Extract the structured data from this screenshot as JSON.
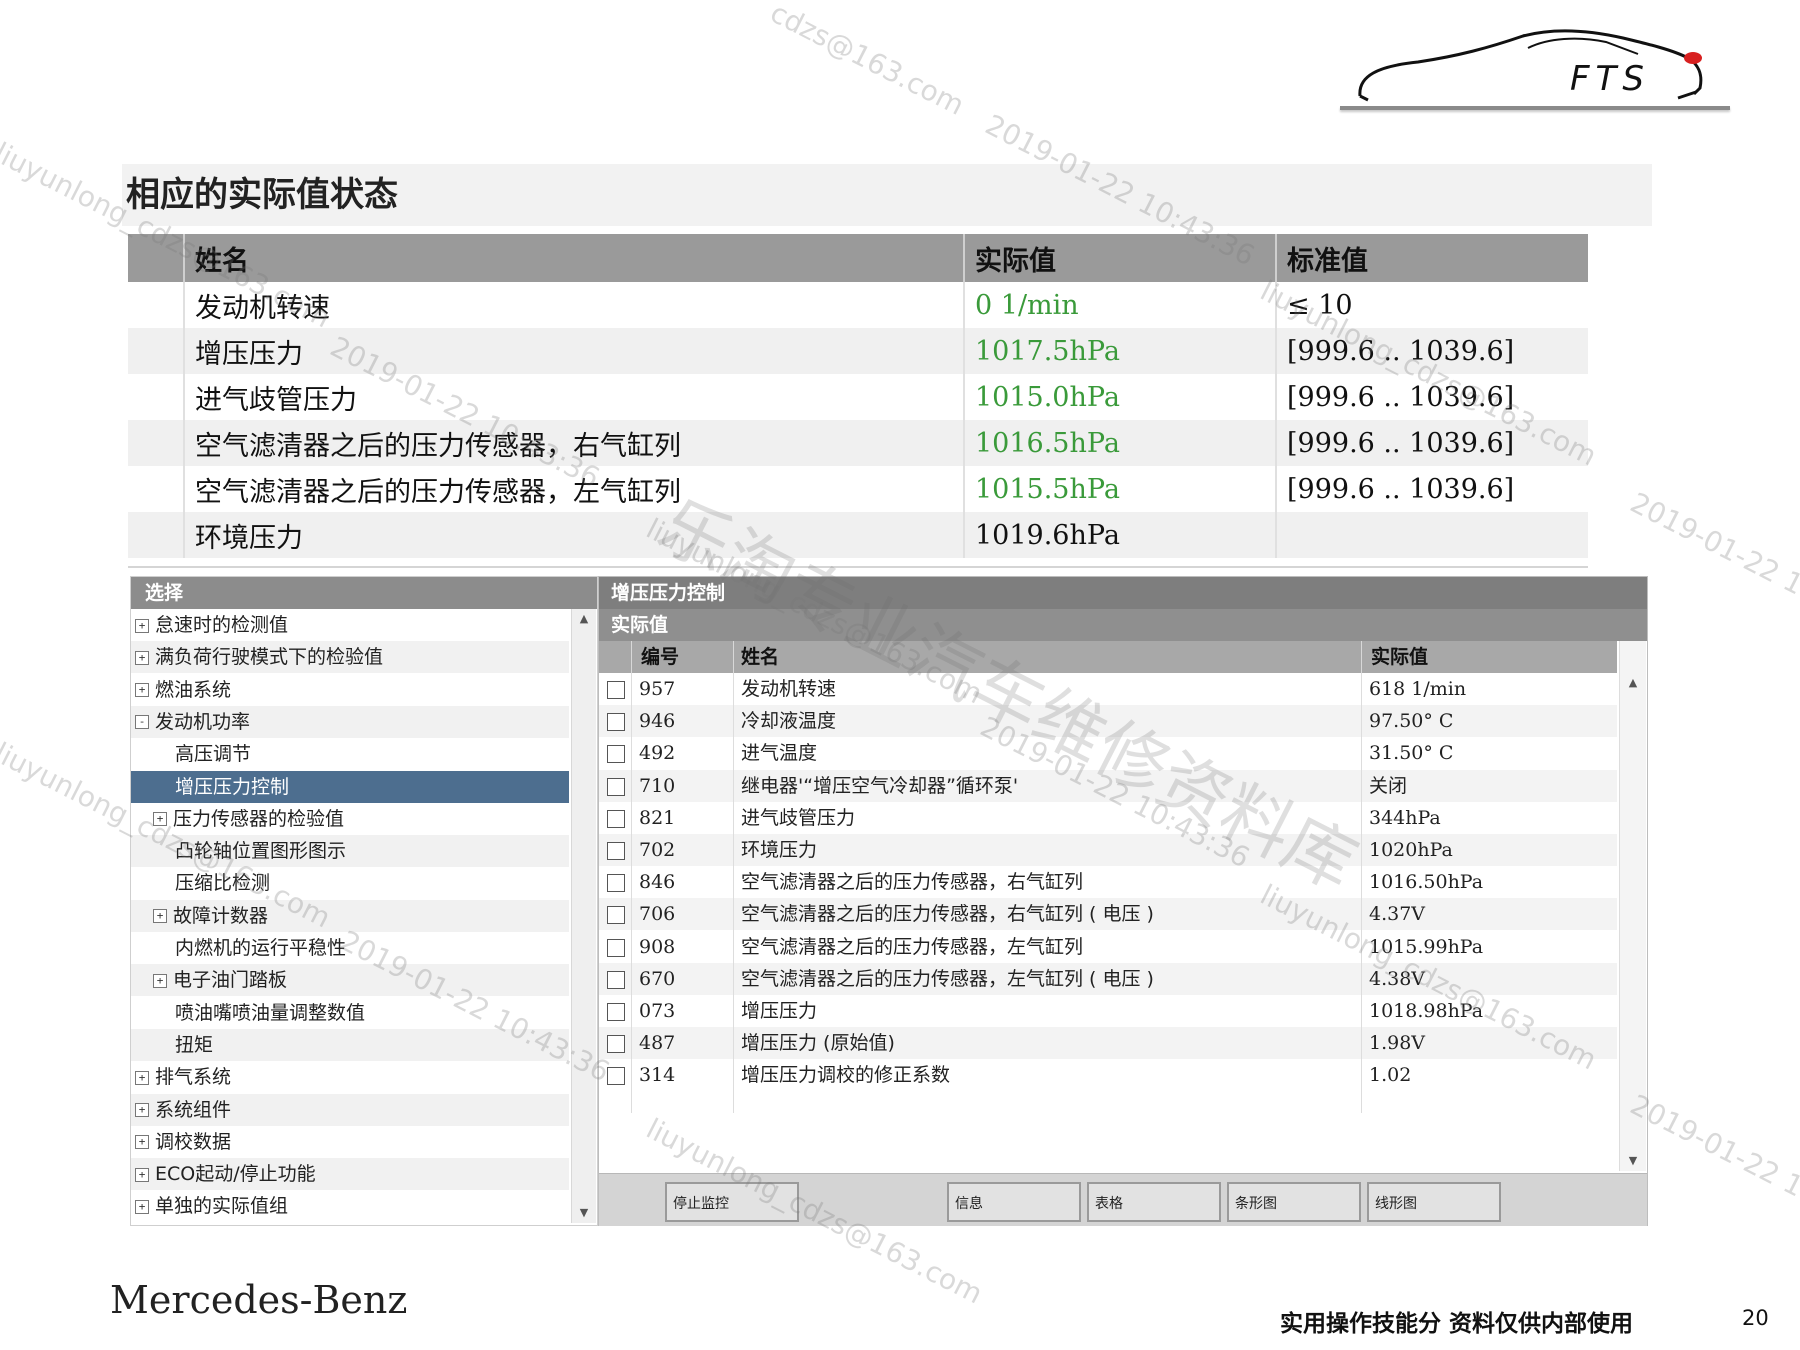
{
  "heading": "相应的实际值状态",
  "upper_table": {
    "headers": [
      "姓名",
      "实际值",
      "标准值"
    ],
    "rows": [
      {
        "name": "发动机转速",
        "actual": "0 1/min",
        "standard": "≤ 10"
      },
      {
        "name": "增压压力",
        "actual": "1017.5hPa",
        "standard": "[999.6 .. 1039.6]"
      },
      {
        "name": "进气歧管压力",
        "actual": "1015.0hPa",
        "standard": "[999.6 .. 1039.6]"
      },
      {
        "name": "空气滤清器之后的压力传感器，右气缸列",
        "actual": "1016.5hPa",
        "standard": "[999.6 .. 1039.6]"
      },
      {
        "name": "空气滤清器之后的压力传感器，左气缸列",
        "actual": "1015.5hPa",
        "standard": "[999.6 .. 1039.6]"
      },
      {
        "name": "环境压力",
        "actual": "1019.6hPa",
        "standard": ""
      }
    ]
  },
  "tree": {
    "header": "选择",
    "items": [
      {
        "label": "怠速时的检测值",
        "expander": "+",
        "indent": 0
      },
      {
        "label": "满负荷行驶模式下的检验值",
        "expander": "+",
        "indent": 0
      },
      {
        "label": "燃油系统",
        "expander": "+",
        "indent": 0
      },
      {
        "label": "发动机功率",
        "expander": "-",
        "indent": 0
      },
      {
        "label": "高压调节",
        "expander": "",
        "indent": 1
      },
      {
        "label": "增压压力控制",
        "expander": "",
        "indent": 1,
        "selected": true
      },
      {
        "label": "压力传感器的检验值",
        "expander": "+",
        "indent": 1
      },
      {
        "label": "凸轮轴位置图形图示",
        "expander": "",
        "indent": 1
      },
      {
        "label": "压缩比检测",
        "expander": "",
        "indent": 1
      },
      {
        "label": "故障计数器",
        "expander": "+",
        "indent": 1
      },
      {
        "label": "内燃机的运行平稳性",
        "expander": "",
        "indent": 1
      },
      {
        "label": "电子油门踏板",
        "expander": "+",
        "indent": 1
      },
      {
        "label": "喷油嘴喷油量调整数值",
        "expander": "",
        "indent": 1
      },
      {
        "label": "扭矩",
        "expander": "",
        "indent": 1
      },
      {
        "label": "排气系统",
        "expander": "+",
        "indent": 0
      },
      {
        "label": "系统组件",
        "expander": "+",
        "indent": 0
      },
      {
        "label": "调校数据",
        "expander": "+",
        "indent": 0
      },
      {
        "label": "ECO起动/停止功能",
        "expander": "+",
        "indent": 0
      },
      {
        "label": "单独的实际值组",
        "expander": "+",
        "indent": 0
      }
    ]
  },
  "panel": {
    "title": "增压压力控制",
    "subtitle": "实际值",
    "columns": [
      "编号",
      "姓名",
      "实际值"
    ],
    "rows": [
      {
        "id": "957",
        "name": "发动机转速",
        "value": "618 1/min"
      },
      {
        "id": "946",
        "name": "冷却液温度",
        "value": "97.50° C"
      },
      {
        "id": "492",
        "name": "进气温度",
        "value": "31.50° C"
      },
      {
        "id": "710",
        "name": "继电器'“增压空气冷却器”循环泵'",
        "value": "关闭"
      },
      {
        "id": "821",
        "name": "进气歧管压力",
        "value": "344hPa"
      },
      {
        "id": "702",
        "name": "环境压力",
        "value": "1020hPa"
      },
      {
        "id": "846",
        "name": "空气滤清器之后的压力传感器，右气缸列",
        "value": "1016.50hPa"
      },
      {
        "id": "706",
        "name": "空气滤清器之后的压力传感器，右气缸列 ( 电压 )",
        "value": "4.37V"
      },
      {
        "id": "908",
        "name": "空气滤清器之后的压力传感器，左气缸列",
        "value": "1015.99hPa"
      },
      {
        "id": "670",
        "name": "空气滤清器之后的压力传感器，左气缸列 ( 电压 )",
        "value": "4.38V"
      },
      {
        "id": "073",
        "name": "增压压力",
        "value": "1018.98hPa"
      },
      {
        "id": "487",
        "name": "增压压力 (原始值)",
        "value": "1.98V"
      },
      {
        "id": "314",
        "name": "增压压力调校的修正系数",
        "value": "1.02"
      }
    ],
    "buttons": [
      "停止监控",
      "信息",
      "表格",
      "条形图",
      "线形图"
    ]
  },
  "logo_text": "FTS",
  "brand": "Mercedes-Benz",
  "footer_note": "实用操作技能分 资料仅供内部使用",
  "page_number": "20",
  "watermarks": {
    "email": "liuyunlong_cdzs@163.com",
    "email_short": "cdzs@163.com",
    "timestamp": "2019-01-22 10:43:36",
    "center": "乐淘专业汽车维修资料库"
  },
  "colors": {
    "header_gray": "#9a9a9a",
    "selection_blue": "#4d6e8f",
    "value_green": "#3a9a3a",
    "logo_red": "#d82020"
  }
}
